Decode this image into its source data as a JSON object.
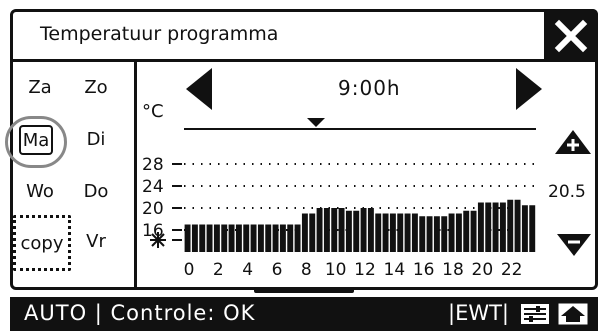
{
  "window": {
    "title": "Temperatuur programma"
  },
  "days": {
    "za": "Za",
    "zo": "Zo",
    "ma": "Ma",
    "di": "Di",
    "wo": "Wo",
    "do": "Do",
    "copy": "copy",
    "vr": "Vr"
  },
  "time_display": "9:00h",
  "unit": "°C",
  "setpoint": "20.5",
  "status": {
    "mode": "AUTO | Controle: OK",
    "ewt": "|EWT|"
  },
  "chart_data": {
    "type": "bar",
    "ylabel": "°C",
    "yticks": [
      "28",
      "24",
      "20",
      "16"
    ],
    "xticks": [
      "0",
      "2",
      "4",
      "6",
      "8",
      "10",
      "12",
      "14",
      "16",
      "18",
      "20",
      "22"
    ],
    "x": [
      0,
      0.5,
      1,
      1.5,
      2,
      2.5,
      3,
      3.5,
      4,
      4.5,
      5,
      5.5,
      6,
      6.5,
      7,
      7.5,
      8,
      8.5,
      9,
      9.5,
      10,
      10.5,
      11,
      11.5,
      12,
      12.5,
      13,
      13.5,
      14,
      14.5,
      15,
      15.5,
      16,
      16.5,
      17,
      17.5,
      18,
      18.5,
      19,
      19.5,
      20,
      20.5,
      21,
      21.5,
      22,
      22.5,
      23,
      23.5
    ],
    "values": [
      17,
      17,
      17,
      17,
      17,
      17,
      17,
      17,
      17,
      17,
      17,
      17,
      17,
      17,
      17,
      17,
      19,
      19,
      20,
      20,
      20,
      20,
      19.5,
      19.5,
      20,
      20,
      19,
      19,
      19,
      19,
      19,
      19,
      18.5,
      18.5,
      18.5,
      18.5,
      19,
      19,
      19.5,
      19.5,
      21,
      21,
      21,
      21,
      21.5,
      21.5,
      20.5,
      20.5
    ],
    "ylim": [
      12,
      30
    ],
    "cursor_time": 9,
    "grid": true
  },
  "colors": {
    "fg": "#111111",
    "bg": "#ffffff",
    "ring": "#888888"
  }
}
